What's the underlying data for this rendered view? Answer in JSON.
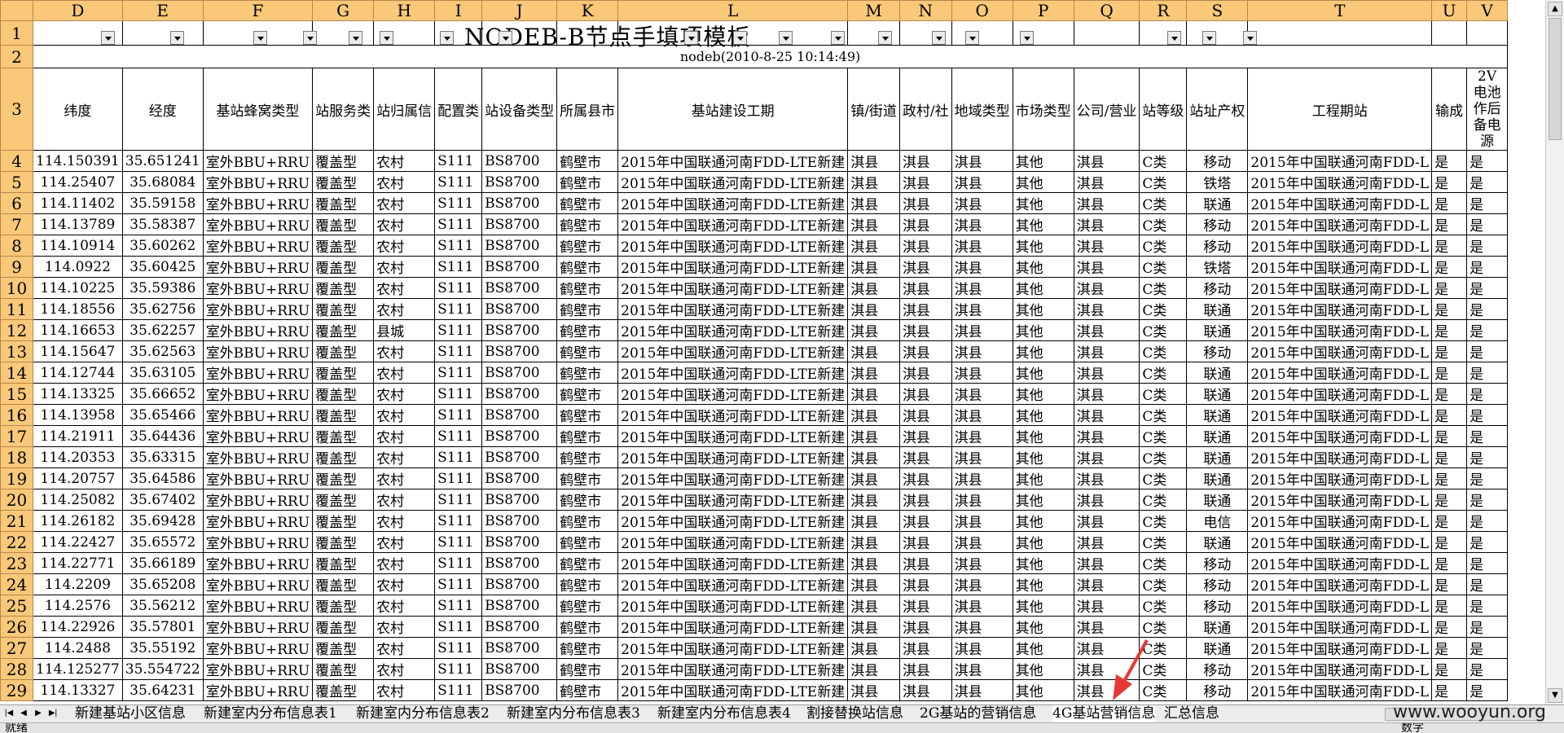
{
  "columns": [
    "D",
    "E",
    "F",
    "G",
    "H",
    "I",
    "J",
    "K",
    "L",
    "M",
    "N",
    "O",
    "P",
    "Q",
    "R",
    "S",
    "T",
    "U",
    "V"
  ],
  "title": "NODEB-B节点手填项模板",
  "subtitle": "nodeb(2010-8-25 10:14:49)",
  "row_numbers": [
    "1",
    "2",
    "3",
    "4",
    "5",
    "6",
    "7",
    "8",
    "9",
    "10",
    "11",
    "12",
    "13",
    "14",
    "15",
    "16",
    "17",
    "18",
    "19",
    "20",
    "21",
    "22",
    "23",
    "24",
    "25",
    "26",
    "27",
    "28",
    "29"
  ],
  "headers": [
    "纬度",
    "经度",
    "基站蜂窝类型",
    "站服务类",
    "站归属信",
    "配置类",
    "站设备类型",
    "所属县市",
    "基站建设工期",
    "镇/街道",
    "政村/社",
    "地域类型",
    "市场类型",
    "公司/营业",
    "站等级",
    "站址产权",
    "工程期站",
    "输成",
    "2V电池作后备电源"
  ],
  "rows": [
    [
      "114.150391",
      "35.651241",
      "室外BBU+RRU",
      "覆盖型",
      "农村",
      "S111",
      "BS8700",
      "鹤壁市",
      "2015年中国联通河南FDD-LTE新建",
      "淇县",
      "淇县",
      "淇县",
      "其他",
      "淇县",
      "C类",
      "移动",
      "2015年中国联通河南FDD-L",
      "是",
      "是"
    ],
    [
      "114.25407",
      "35.68084",
      "室外BBU+RRU",
      "覆盖型",
      "农村",
      "S111",
      "BS8700",
      "鹤壁市",
      "2015年中国联通河南FDD-LTE新建",
      "淇县",
      "淇县",
      "淇县",
      "其他",
      "淇县",
      "C类",
      "铁塔",
      "2015年中国联通河南FDD-L",
      "是",
      "是"
    ],
    [
      "114.11402",
      "35.59158",
      "室外BBU+RRU",
      "覆盖型",
      "农村",
      "S111",
      "BS8700",
      "鹤壁市",
      "2015年中国联通河南FDD-LTE新建",
      "淇县",
      "淇县",
      "淇县",
      "其他",
      "淇县",
      "C类",
      "联通",
      "2015年中国联通河南FDD-L",
      "是",
      "是"
    ],
    [
      "114.13789",
      "35.58387",
      "室外BBU+RRU",
      "覆盖型",
      "农村",
      "S111",
      "BS8700",
      "鹤壁市",
      "2015年中国联通河南FDD-LTE新建",
      "淇县",
      "淇县",
      "淇县",
      "其他",
      "淇县",
      "C类",
      "移动",
      "2015年中国联通河南FDD-L",
      "是",
      "是"
    ],
    [
      "114.10914",
      "35.60262",
      "室外BBU+RRU",
      "覆盖型",
      "农村",
      "S111",
      "BS8700",
      "鹤壁市",
      "2015年中国联通河南FDD-LTE新建",
      "淇县",
      "淇县",
      "淇县",
      "其他",
      "淇县",
      "C类",
      "移动",
      "2015年中国联通河南FDD-L",
      "是",
      "是"
    ],
    [
      "114.0922",
      "35.60425",
      "室外BBU+RRU",
      "覆盖型",
      "农村",
      "S111",
      "BS8700",
      "鹤壁市",
      "2015年中国联通河南FDD-LTE新建",
      "淇县",
      "淇县",
      "淇县",
      "其他",
      "淇县",
      "C类",
      "铁塔",
      "2015年中国联通河南FDD-L",
      "是",
      "是"
    ],
    [
      "114.10225",
      "35.59386",
      "室外BBU+RRU",
      "覆盖型",
      "农村",
      "S111",
      "BS8700",
      "鹤壁市",
      "2015年中国联通河南FDD-LTE新建",
      "淇县",
      "淇县",
      "淇县",
      "其他",
      "淇县",
      "C类",
      "移动",
      "2015年中国联通河南FDD-L",
      "是",
      "是"
    ],
    [
      "114.18556",
      "35.62756",
      "室外BBU+RRU",
      "覆盖型",
      "农村",
      "S111",
      "BS8700",
      "鹤壁市",
      "2015年中国联通河南FDD-LTE新建",
      "淇县",
      "淇县",
      "淇县",
      "其他",
      "淇县",
      "C类",
      "联通",
      "2015年中国联通河南FDD-L",
      "是",
      "是"
    ],
    [
      "114.16653",
      "35.62257",
      "室外BBU+RRU",
      "覆盖型",
      "县城",
      "S111",
      "BS8700",
      "鹤壁市",
      "2015年中国联通河南FDD-LTE新建",
      "淇县",
      "淇县",
      "淇县",
      "其他",
      "淇县",
      "C类",
      "联通",
      "2015年中国联通河南FDD-L",
      "是",
      "是"
    ],
    [
      "114.15647",
      "35.62563",
      "室外BBU+RRU",
      "覆盖型",
      "农村",
      "S111",
      "BS8700",
      "鹤壁市",
      "2015年中国联通河南FDD-LTE新建",
      "淇县",
      "淇县",
      "淇县",
      "其他",
      "淇县",
      "C类",
      "移动",
      "2015年中国联通河南FDD-L",
      "是",
      "是"
    ],
    [
      "114.12744",
      "35.63105",
      "室外BBU+RRU",
      "覆盖型",
      "农村",
      "S111",
      "BS8700",
      "鹤壁市",
      "2015年中国联通河南FDD-LTE新建",
      "淇县",
      "淇县",
      "淇县",
      "其他",
      "淇县",
      "C类",
      "联通",
      "2015年中国联通河南FDD-L",
      "是",
      "是"
    ],
    [
      "114.13325",
      "35.66652",
      "室外BBU+RRU",
      "覆盖型",
      "农村",
      "S111",
      "BS8700",
      "鹤壁市",
      "2015年中国联通河南FDD-LTE新建",
      "淇县",
      "淇县",
      "淇县",
      "其他",
      "淇县",
      "C类",
      "联通",
      "2015年中国联通河南FDD-L",
      "是",
      "是"
    ],
    [
      "114.13958",
      "35.65466",
      "室外BBU+RRU",
      "覆盖型",
      "农村",
      "S111",
      "BS8700",
      "鹤壁市",
      "2015年中国联通河南FDD-LTE新建",
      "淇县",
      "淇县",
      "淇县",
      "其他",
      "淇县",
      "C类",
      "联通",
      "2015年中国联通河南FDD-L",
      "是",
      "是"
    ],
    [
      "114.21911",
      "35.64436",
      "室外BBU+RRU",
      "覆盖型",
      "农村",
      "S111",
      "BS8700",
      "鹤壁市",
      "2015年中国联通河南FDD-LTE新建",
      "淇县",
      "淇县",
      "淇县",
      "其他",
      "淇县",
      "C类",
      "联通",
      "2015年中国联通河南FDD-L",
      "是",
      "是"
    ],
    [
      "114.20353",
      "35.63315",
      "室外BBU+RRU",
      "覆盖型",
      "农村",
      "S111",
      "BS8700",
      "鹤壁市",
      "2015年中国联通河南FDD-LTE新建",
      "淇县",
      "淇县",
      "淇县",
      "其他",
      "淇县",
      "C类",
      "联通",
      "2015年中国联通河南FDD-L",
      "是",
      "是"
    ],
    [
      "114.20757",
      "35.64586",
      "室外BBU+RRU",
      "覆盖型",
      "农村",
      "S111",
      "BS8700",
      "鹤壁市",
      "2015年中国联通河南FDD-LTE新建",
      "淇县",
      "淇县",
      "淇县",
      "其他",
      "淇县",
      "C类",
      "联通",
      "2015年中国联通河南FDD-L",
      "是",
      "是"
    ],
    [
      "114.25082",
      "35.67402",
      "室外BBU+RRU",
      "覆盖型",
      "农村",
      "S111",
      "BS8700",
      "鹤壁市",
      "2015年中国联通河南FDD-LTE新建",
      "淇县",
      "淇县",
      "淇县",
      "其他",
      "淇县",
      "C类",
      "联通",
      "2015年中国联通河南FDD-L",
      "是",
      "是"
    ],
    [
      "114.26182",
      "35.69428",
      "室外BBU+RRU",
      "覆盖型",
      "农村",
      "S111",
      "BS8700",
      "鹤壁市",
      "2015年中国联通河南FDD-LTE新建",
      "淇县",
      "淇县",
      "淇县",
      "其他",
      "淇县",
      "C类",
      "电信",
      "2015年中国联通河南FDD-L",
      "是",
      "是"
    ],
    [
      "114.22427",
      "35.65572",
      "室外BBU+RRU",
      "覆盖型",
      "农村",
      "S111",
      "BS8700",
      "鹤壁市",
      "2015年中国联通河南FDD-LTE新建",
      "淇县",
      "淇县",
      "淇县",
      "其他",
      "淇县",
      "C类",
      "联通",
      "2015年中国联通河南FDD-L",
      "是",
      "是"
    ],
    [
      "114.22771",
      "35.66189",
      "室外BBU+RRU",
      "覆盖型",
      "农村",
      "S111",
      "BS8700",
      "鹤壁市",
      "2015年中国联通河南FDD-LTE新建",
      "淇县",
      "淇县",
      "淇县",
      "其他",
      "淇县",
      "C类",
      "移动",
      "2015年中国联通河南FDD-L",
      "是",
      "是"
    ],
    [
      "114.2209",
      "35.65208",
      "室外BBU+RRU",
      "覆盖型",
      "农村",
      "S111",
      "BS8700",
      "鹤壁市",
      "2015年中国联通河南FDD-LTE新建",
      "淇县",
      "淇县",
      "淇县",
      "其他",
      "淇县",
      "C类",
      "移动",
      "2015年中国联通河南FDD-L",
      "是",
      "是"
    ],
    [
      "114.2576",
      "35.56212",
      "室外BBU+RRU",
      "覆盖型",
      "农村",
      "S111",
      "BS8700",
      "鹤壁市",
      "2015年中国联通河南FDD-LTE新建",
      "淇县",
      "淇县",
      "淇县",
      "其他",
      "淇县",
      "C类",
      "移动",
      "2015年中国联通河南FDD-L",
      "是",
      "是"
    ],
    [
      "114.22926",
      "35.57801",
      "室外BBU+RRU",
      "覆盖型",
      "农村",
      "S111",
      "BS8700",
      "鹤壁市",
      "2015年中国联通河南FDD-LTE新建",
      "淇县",
      "淇县",
      "淇县",
      "其他",
      "淇县",
      "C类",
      "联通",
      "2015年中国联通河南FDD-L",
      "是",
      "是"
    ],
    [
      "114.2488",
      "35.55192",
      "室外BBU+RRU",
      "覆盖型",
      "农村",
      "S111",
      "BS8700",
      "鹤壁市",
      "2015年中国联通河南FDD-LTE新建",
      "淇县",
      "淇县",
      "淇县",
      "其他",
      "淇县",
      "C类",
      "联通",
      "2015年中国联通河南FDD-L",
      "是",
      "是"
    ],
    [
      "114.125277",
      "35.554722",
      "室外BBU+RRU",
      "覆盖型",
      "农村",
      "S111",
      "BS8700",
      "鹤壁市",
      "2015年中国联通河南FDD-LTE新建",
      "淇县",
      "淇县",
      "淇县",
      "其他",
      "淇县",
      "C类",
      "移动",
      "2015年中国联通河南FDD-L",
      "是",
      "是"
    ],
    [
      "114.13327",
      "35.64231",
      "室外BBU+RRU",
      "覆盖型",
      "农村",
      "S111",
      "BS8700",
      "鹤壁市",
      "2015年中国联通河南FDD-LTE新建",
      "淇县",
      "淇县",
      "淇县",
      "其他",
      "淇县",
      "C类",
      "移动",
      "2015年中国联通河南FDD-L",
      "是",
      "是"
    ]
  ],
  "sheet_tabs": [
    "新建基站小区信息",
    "新建室内分布信息表1",
    "新建室内分布信息表2",
    "新建室内分布信息表3",
    "新建室内分布信息表4",
    "割接替换站信息",
    "2G基站的营销信息",
    "4G基站营销信息",
    "汇总信息"
  ],
  "active_tab": "4G基站营销信息",
  "status": {
    "left": "就绪",
    "right": "数字"
  },
  "watermark": "www.wooyun.org",
  "colors": {
    "header_bg": "#f9c879",
    "arrow": "#e53935"
  }
}
